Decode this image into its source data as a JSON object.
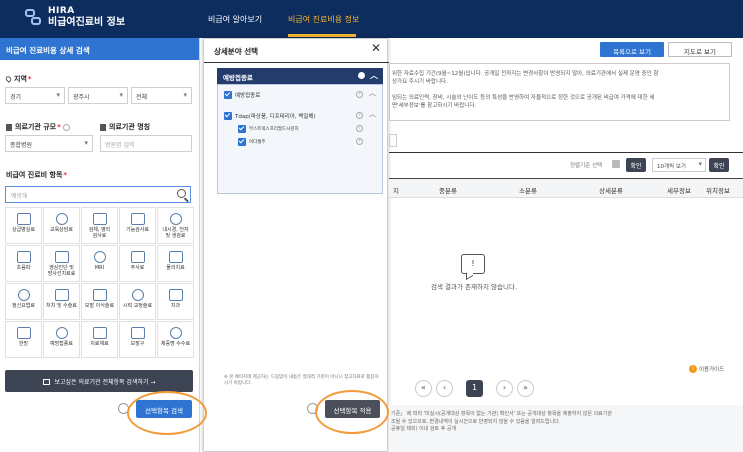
{
  "header": {
    "logo_en": "HIRA",
    "logo_ko": "비급여진료비 정보",
    "nav": [
      "비급여 알아보기",
      "비급여 진료비용 정보"
    ]
  },
  "left_panel": {
    "title": "비급여 진료비용 상세 검색",
    "region_label": "지역",
    "region_selects": [
      "경기",
      "광주시",
      "전체"
    ],
    "size_label": "의료기관 규모",
    "size_select": "종합병원",
    "name_label": "의료기관 명칭",
    "name_placeholder": "병원명 입력",
    "items_label": "비급여 진료비 항목",
    "search_placeholder": "예방해",
    "categories": [
      {
        "label": "상급병실료",
        "icon": "bed-icon"
      },
      {
        "label": "교육상담료",
        "icon": "consult-icon"
      },
      {
        "label": "검체, 병리\n검사료",
        "icon": "lab-icon"
      },
      {
        "label": "기능검사료",
        "icon": "function-test-icon"
      },
      {
        "label": "내시경, 천자\n및 생검료",
        "icon": "endoscope-icon"
      },
      {
        "label": "초음파",
        "icon": "ultrasound-icon"
      },
      {
        "label": "영상진단 및\n방사선치료료",
        "icon": "radiology-icon"
      },
      {
        "label": "MRI",
        "icon": "mri-icon"
      },
      {
        "label": "주사료",
        "icon": "syringe-icon"
      },
      {
        "label": "물리치료",
        "icon": "physio-icon"
      },
      {
        "label": "정신요법료",
        "icon": "mental-icon"
      },
      {
        "label": "처치 및 수술료",
        "icon": "surgery-icon"
      },
      {
        "label": "모발 이식술료",
        "icon": "hair-icon"
      },
      {
        "label": "시력 교정술료",
        "icon": "eye-icon"
      },
      {
        "label": "치과",
        "icon": "tooth-icon"
      },
      {
        "label": "한방",
        "icon": "herbal-icon"
      },
      {
        "label": "예방접종료",
        "icon": "vaccine-icon"
      },
      {
        "label": "치료재료",
        "icon": "material-icon"
      },
      {
        "label": "보장구",
        "icon": "brace-icon"
      },
      {
        "label": "제증명 수수료",
        "icon": "certificate-icon"
      }
    ],
    "dark_bar": "보고싶은 의료기관 전체항목 검색하기 →",
    "search_button": "선택항목 검색"
  },
  "modal": {
    "title": "상세분야 선택",
    "category": "예방접종료",
    "group": "예방접종료",
    "item": "Tdap(파상풍, 디프테리아, 백일해)",
    "subitems": [
      "부스트릭스프리필드시린지",
      "아다셀주"
    ],
    "note": "※ 본 페이지에 제공하는 드림맞이 내용은 절대적 기준이 아니니 참고자료로 활용하시기 바랍니다.",
    "apply_button": "선택항목 적용"
  },
  "right": {
    "btn_list": "목록으로 보기",
    "btn_map": "지도로 보기",
    "notice_lines": [
      "위한 자료수집 기간(9월~12월)입니다. 공개일 전까지는 변경사항이 반영되지 않아, 의료기관에서 실제 운영 중인 항",
      "상가요 주시기 바랍니다.",
      "",
      "임되는 의료인력, 장비, 시술의 난이도 등의 특성을 반영하여 자율적으로 정한 것으로 공개된 비급여 가격에 대한 세",
      "면'세부정보'를 참고하시기 바랍니다."
    ],
    "sort_label": "정렬기준 선택",
    "confirm": "확인",
    "per_page": "10개씩 보기",
    "columns": [
      "지",
      "중분류",
      "소분류",
      "상세분류",
      "세부정보",
      "위치정보"
    ],
    "empty_text": "검색 결과가 존재하지 않습니다.",
    "help": "이용가이드",
    "pagination": [
      "«",
      "‹",
      "1",
      "›",
      "»"
    ],
    "footer_lines": [
      "기준」 에 따라 '미실시(공개대상 항목이 없는 기관) 확인서' 또는 공개대상 항목을 제출하지 않은 의료기관",
      "조될 수 있으므로, 변경내역이 실시간으로 반영되지 않을 수 있음을 알려드립니다.",
      "공휴일 제외) 이내 검토 후 공개"
    ]
  }
}
